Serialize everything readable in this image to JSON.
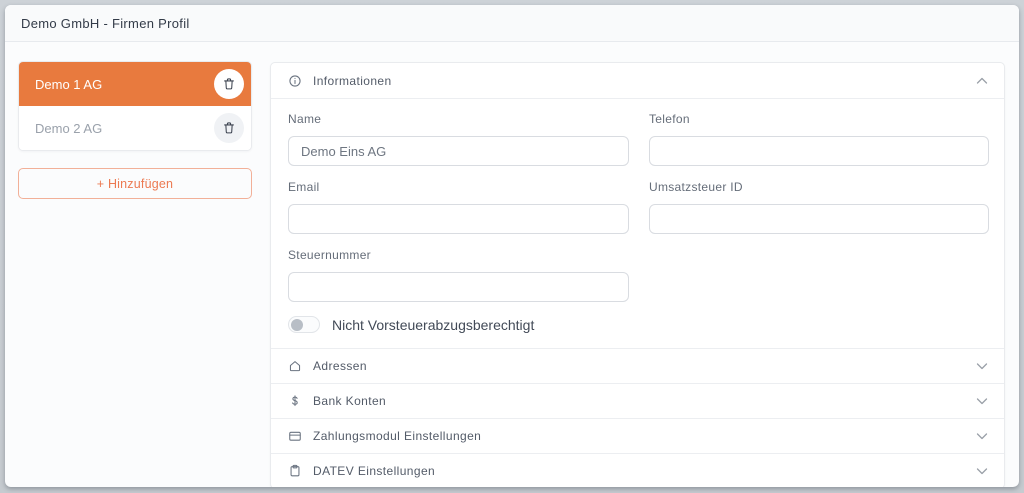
{
  "window": {
    "title": "Demo GmbH - Firmen Profil"
  },
  "sidebar": {
    "companies": [
      {
        "name": "Demo 1 AG",
        "selected": true
      },
      {
        "name": "Demo 2 AG",
        "selected": false
      }
    ],
    "add_button_label": "+ Hinzufügen"
  },
  "panel": {
    "sections": [
      {
        "label": "Informationen",
        "icon": "info-icon",
        "state": "expanded"
      },
      {
        "label": "Adressen",
        "icon": "home-icon",
        "state": "collapsed"
      },
      {
        "label": "Bank Konten",
        "icon": "dollar-icon",
        "state": "collapsed"
      },
      {
        "label": "Zahlungsmodul Einstellungen",
        "icon": "credit-card-icon",
        "state": "collapsed"
      },
      {
        "label": "DATEV Einstellungen",
        "icon": "clipboard-icon",
        "state": "collapsed"
      }
    ],
    "form": {
      "fields": [
        {
          "label": "Name",
          "value": "Demo Eins AG"
        },
        {
          "label": "Telefon",
          "value": ""
        },
        {
          "label": "Email",
          "value": ""
        },
        {
          "label": "Umsatzsteuer ID",
          "value": ""
        },
        {
          "label": "Steuernummer",
          "value": ""
        }
      ],
      "toggle": {
        "label": "Nicht Vorsteuerabzugsberechtigt",
        "state": "off"
      }
    }
  },
  "colors": {
    "accent_orange": "#E87A3E",
    "accent_coral": "#EC7A52",
    "accent_coral_border": "#F2B098"
  }
}
